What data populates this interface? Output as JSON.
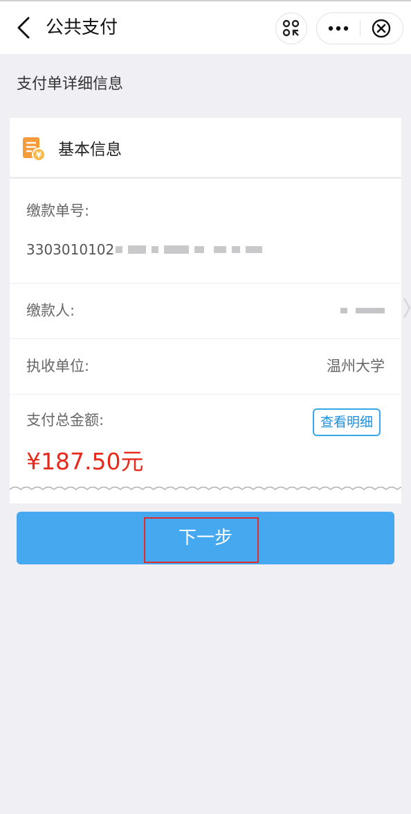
{
  "header": {
    "title": "公共支付",
    "back_icon": "chevron-left-icon",
    "scan_icon": "scan-icon",
    "more_icon": "more-dots-icon",
    "close_icon": "close-circle-icon"
  },
  "section": {
    "title": "支付单详细信息"
  },
  "card": {
    "head_title": "基本信息",
    "head_icon": "bill-icon",
    "payment_no_label": "缴款单号:",
    "payment_no_value": "3303010102",
    "payer_label": "缴款人:",
    "unit_label": "执收单位:",
    "unit_value": "温州大学",
    "amount_label": "支付总金额:",
    "detail_button": "查看明细",
    "amount_value": "¥187.50元"
  },
  "actions": {
    "next_label": "下一步"
  },
  "colors": {
    "accent": "#46a8ef",
    "amount": "#e8281b",
    "background": "#efeff4",
    "highlight": "#e32a2a"
  }
}
